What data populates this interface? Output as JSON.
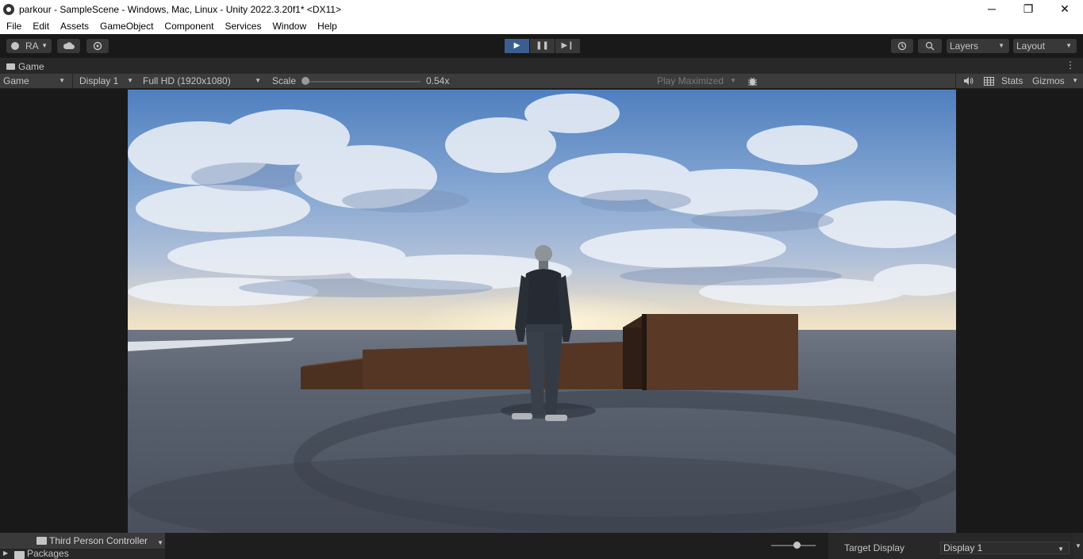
{
  "window": {
    "title": "parkour - SampleScene - Windows, Mac, Linux - Unity 2022.3.20f1* <DX11>",
    "minimize": "─",
    "restore": "❐",
    "close": "✕"
  },
  "menu": [
    "File",
    "Edit",
    "Assets",
    "GameObject",
    "Component",
    "Services",
    "Window",
    "Help"
  ],
  "toolbar": {
    "account": "RA",
    "layers": "Layers",
    "layout": "Layout",
    "play_icon": "▶",
    "pause_icon": "❚❚",
    "step_icon": "▶❙"
  },
  "game_panel": {
    "tab_label": "Game",
    "menu_icon": "⋮",
    "view_mode": "Game",
    "display": "Display 1",
    "resolution": "Full HD (1920x1080)",
    "scale_label": "Scale",
    "scale_value": "0.54x",
    "scale_fraction": 0.0,
    "play_maximized": "Play Maximized",
    "stats": "Stats",
    "gizmos": "Gizmos"
  },
  "bottom": {
    "folder_label": "Third Person Controller",
    "packages_label": "Packages",
    "target_display_label": "Target Display",
    "target_display_value": "Display 1"
  },
  "icons": {
    "account": "person-icon",
    "cloud": "cloud-icon",
    "collab": "collab-icon",
    "history": "history-icon",
    "search": "search-icon",
    "bug": "bug-icon",
    "audio": "speaker-icon",
    "grid": "grid-icon",
    "folder": "folder-icon"
  },
  "colors": {
    "editor_bg": "#191919",
    "panel_bg": "#3c3c3c",
    "play_active": "#3a5f8f",
    "text": "#c4c4c4"
  }
}
